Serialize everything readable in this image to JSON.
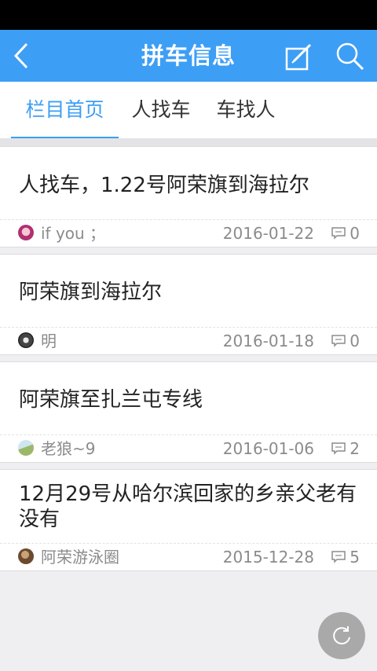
{
  "header": {
    "title": "拼车信息"
  },
  "tabs": [
    {
      "label": "栏目首页"
    },
    {
      "label": "人找车"
    },
    {
      "label": "车找人"
    }
  ],
  "posts": [
    {
      "title": "人找车，1.22号阿荣旗到海拉尔",
      "author": "if you ；",
      "date": "2016-01-22",
      "comments": "0"
    },
    {
      "title": "阿荣旗到海拉尔",
      "author": "明",
      "date": "2016-01-18",
      "comments": "0"
    },
    {
      "title": "阿荣旗至扎兰屯专线",
      "author": "老狼~9",
      "date": "2016-01-06",
      "comments": "2"
    },
    {
      "title": "12月29号从哈尔滨回家的乡亲父老有没有",
      "author": "阿荣游泳圈",
      "date": "2015-12-28",
      "comments": "5"
    }
  ],
  "colors": {
    "accent": "#3d9ef5",
    "background": "#efeff1"
  },
  "icons": {
    "back": "back-arrow-icon",
    "edit": "edit-icon",
    "search": "search-icon",
    "comment": "comment-icon",
    "refresh": "refresh-icon"
  }
}
